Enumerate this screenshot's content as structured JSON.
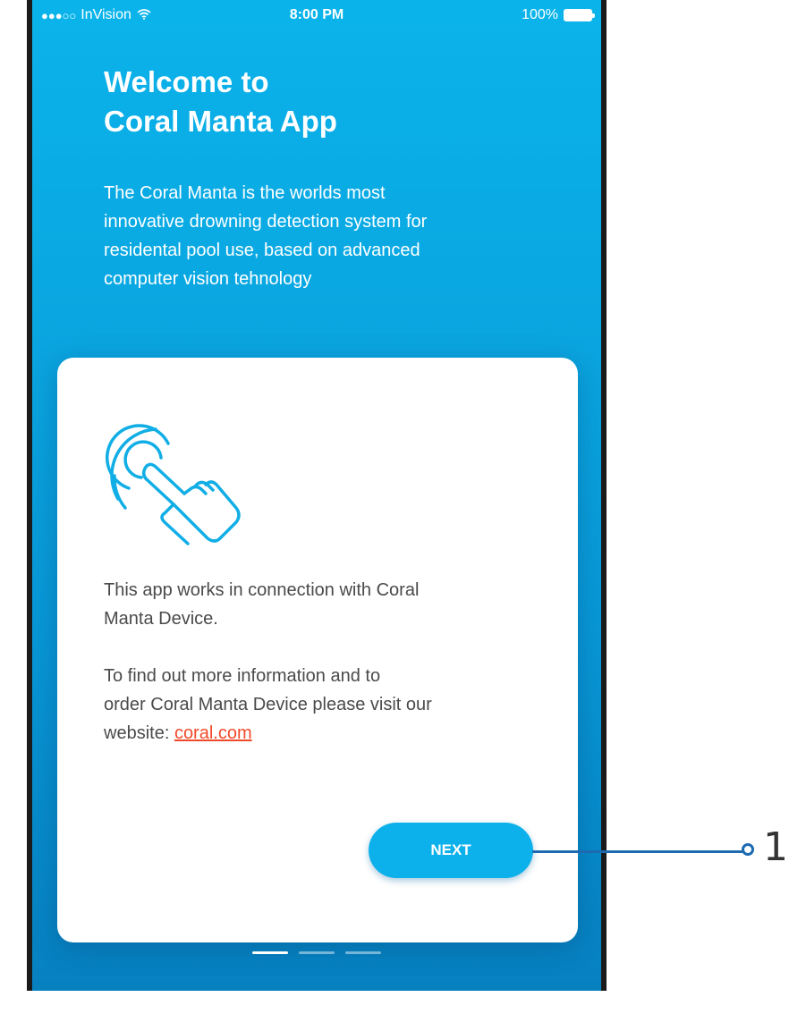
{
  "status_bar": {
    "signal_dots": "●●●○○",
    "carrier": "InVision",
    "wifi_icon": "wifi-icon",
    "time": "8:00 PM",
    "battery_percent": "100%",
    "battery_level": 1.0
  },
  "header": {
    "title_line1": "Welcome to",
    "title_line2": "Coral Manta App",
    "intro_line1": "The Coral Manta is the worlds most",
    "intro_line2": "innovative drowning detection system for",
    "intro_line3": "residental pool use, based on advanced",
    "intro_line4": "computer vision tehnology"
  },
  "card": {
    "icon": "touch-hand-icon",
    "paragraph1_line1": "This app works in connection with Coral",
    "paragraph1_line2": "Manta Device.",
    "paragraph2_line1": "To find out more information and to",
    "paragraph2_line2": "order Coral Manta Device please visit our",
    "paragraph2_prefix": "website: ",
    "link_text": "coral.com",
    "next_label": "NEXT"
  },
  "pagination": {
    "total": 3,
    "active": 1
  },
  "annotation": {
    "label": "1"
  },
  "colors": {
    "brand_blue": "#0bb3ea",
    "link_red": "#f04a2a",
    "callout_blue": "#1d6ab1"
  }
}
